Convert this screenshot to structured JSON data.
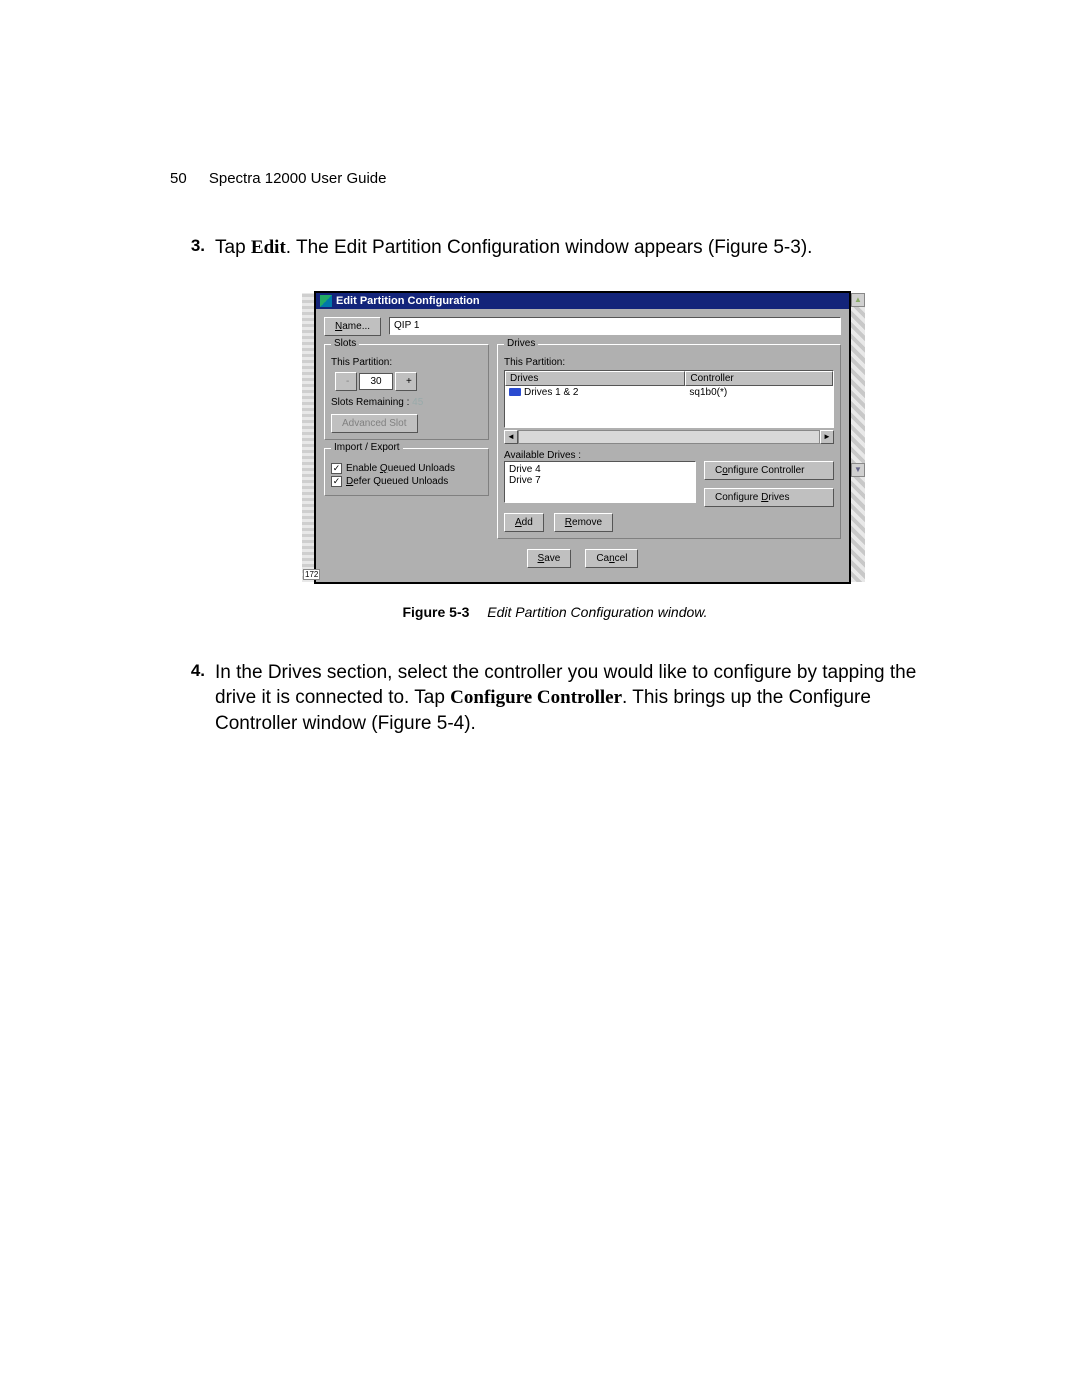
{
  "header": {
    "page_number": "50",
    "doc_title": "Spectra 12000 User Guide"
  },
  "step3": {
    "num": "3.",
    "pre": "Tap ",
    "bold": "Edit",
    "post": ". The Edit Partition Configuration window appears (Figure 5-3)."
  },
  "window": {
    "title": "Edit Partition Configuration",
    "name_btn_pre": "N",
    "name_btn_rest": "ame...",
    "name_value": "QIP 1",
    "slots": {
      "legend": "Slots",
      "this_partition": "This Partition:",
      "minus": "-",
      "value": "30",
      "plus": "+",
      "remaining_label": "Slots Remaining :",
      "remaining_value": "45",
      "adv_btn": "Advanced Slot"
    },
    "impexp": {
      "legend": "Import / Export",
      "chk1_pre": "Enable ",
      "chk1_u": "Q",
      "chk1_post": "ueued Unloads",
      "chk2_pre": "",
      "chk2_u": "D",
      "chk2_post": "efer Queued Unloads"
    },
    "drives": {
      "legend": "Drives",
      "this_partition": "This Partition:",
      "col_a": "Drives",
      "col_b": "Controller",
      "row_a": "Drives 1 & 2",
      "row_b": "sq1b0(*)",
      "avail_label": "Available Drives :",
      "avail_1": "Drive 4",
      "avail_2": "Drive 7",
      "cfg_ctl_pre": "C",
      "cfg_ctl_u": "o",
      "cfg_ctl_post": "nfigure Controller",
      "cfg_drv_pre": "Configure ",
      "cfg_drv_u": "D",
      "cfg_drv_post": "rives",
      "add_u": "A",
      "add_post": "dd",
      "rem_u": "R",
      "rem_post": "emove"
    },
    "bottom": {
      "save_u": "S",
      "save_post": "ave",
      "cancel_pre": "Ca",
      "cancel_u": "n",
      "cancel_post": "cel"
    },
    "ticker": "172"
  },
  "figure": {
    "label": "Figure 5-3",
    "caption": "Edit Partition Configuration window."
  },
  "step4": {
    "num": "4.",
    "t1": "In the Drives section, select the controller you would like to configure by tapping the drive it is connected to. Tap ",
    "b1": "Configure Controller",
    "t2": ". This brings up the Configure Controller window (Figure 5-4)."
  }
}
